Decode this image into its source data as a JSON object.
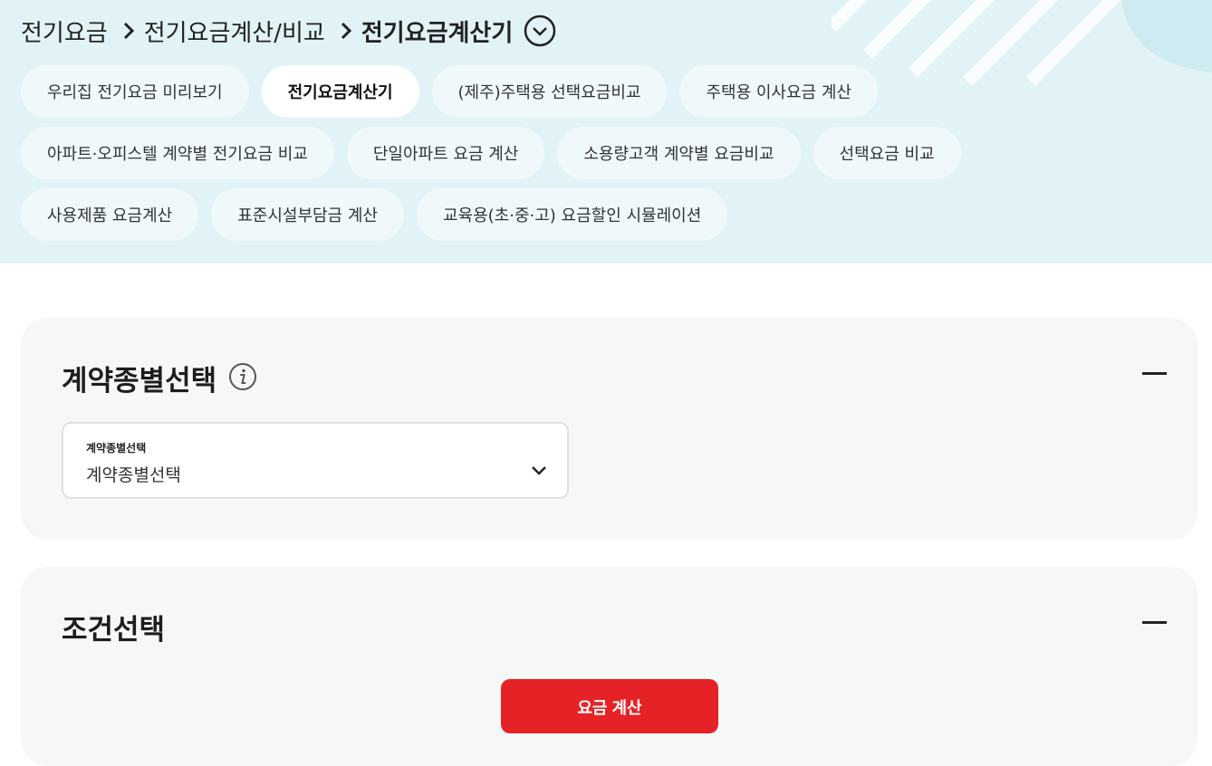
{
  "breadcrumb": {
    "items": [
      "전기요금",
      "전기요금계산/비교"
    ],
    "current": "전기요금계산기"
  },
  "tabs": {
    "row1": [
      "우리집 전기요금 미리보기",
      "전기요금계산기",
      "(제주)주택용 선택요금비교",
      "주택용 이사요금 계산"
    ],
    "row2": [
      "아파트·오피스텔 계약별 전기요금 비교",
      "단일아파트 요금 계산",
      "소용량고객 계약별 요금비교",
      "선택요금 비교"
    ],
    "row3": [
      "사용제품 요금계산",
      "표준시설부담금 계산",
      "교육용(초·중·고) 요금할인 시뮬레이션"
    ],
    "active": "전기요금계산기"
  },
  "contract_section": {
    "title": "계약종별선택",
    "select_label": "계약종별선택",
    "select_value": "계약종별선택"
  },
  "condition_section": {
    "title": "조건선택",
    "calc_button": "요금 계산"
  },
  "colors": {
    "hero_bg": "#e2f3f7",
    "tab_bg": "#eff9fb",
    "panel_bg": "#f6f7f7",
    "primary_red": "#e52327"
  }
}
